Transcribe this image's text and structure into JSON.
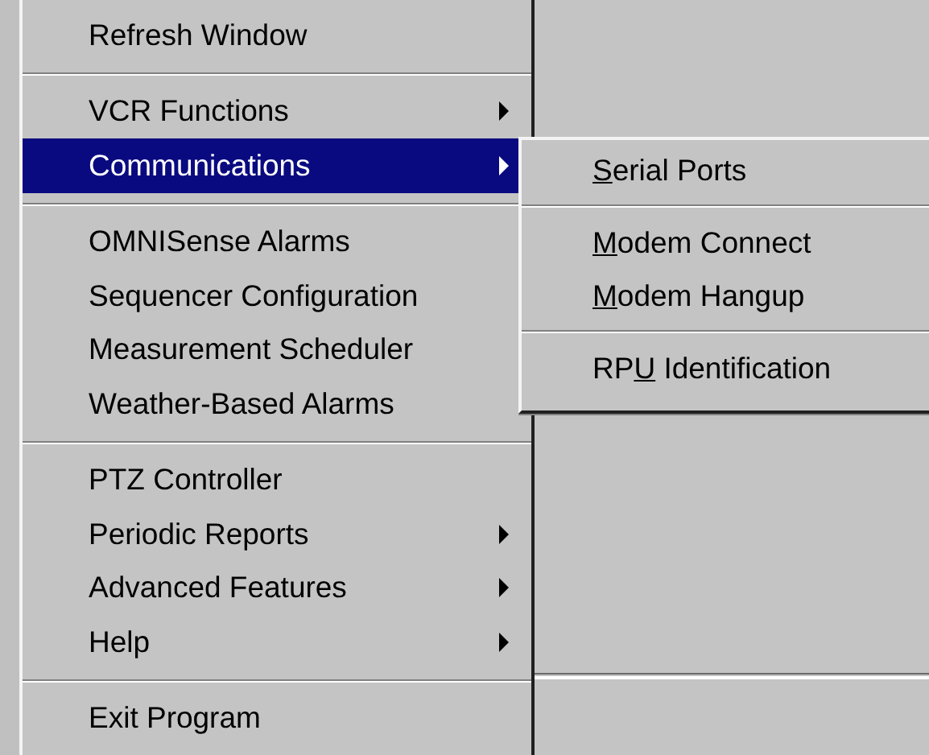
{
  "main_menu": {
    "items": [
      {
        "kind": "item",
        "label": "Refresh Window",
        "submenu": false,
        "selected": false
      },
      {
        "kind": "separator"
      },
      {
        "kind": "item",
        "label": "VCR Functions",
        "submenu": true,
        "selected": false
      },
      {
        "kind": "item",
        "label": "Communications",
        "submenu": true,
        "selected": true
      },
      {
        "kind": "separator"
      },
      {
        "kind": "item",
        "label": "OMNISense Alarms",
        "submenu": false,
        "selected": false
      },
      {
        "kind": "item",
        "label": "Sequencer Configuration",
        "submenu": false,
        "selected": false
      },
      {
        "kind": "item",
        "label": "Measurement Scheduler",
        "submenu": false,
        "selected": false
      },
      {
        "kind": "item",
        "label": "Weather-Based Alarms",
        "submenu": false,
        "selected": false
      },
      {
        "kind": "separator"
      },
      {
        "kind": "item",
        "label": "PTZ Controller",
        "submenu": false,
        "selected": false
      },
      {
        "kind": "item",
        "label": "Periodic Reports",
        "submenu": true,
        "selected": false
      },
      {
        "kind": "item",
        "label": "Advanced Features",
        "submenu": true,
        "selected": false
      },
      {
        "kind": "item",
        "label": "Help",
        "submenu": true,
        "selected": false
      },
      {
        "kind": "separator"
      },
      {
        "kind": "item",
        "label": "Exit Program",
        "submenu": false,
        "selected": false
      }
    ]
  },
  "submenu": {
    "items": [
      {
        "kind": "item",
        "mnemonic": "S",
        "label_rest": "erial Ports"
      },
      {
        "kind": "separator"
      },
      {
        "kind": "item",
        "mnemonic": "M",
        "label_rest": "odem Connect"
      },
      {
        "kind": "item",
        "mnemonic": "M",
        "label_rest": "odem Hangup"
      },
      {
        "kind": "separator"
      },
      {
        "kind": "item",
        "label_start": "RP",
        "mnemonic": "U",
        "label_rest": " Identification"
      }
    ]
  }
}
